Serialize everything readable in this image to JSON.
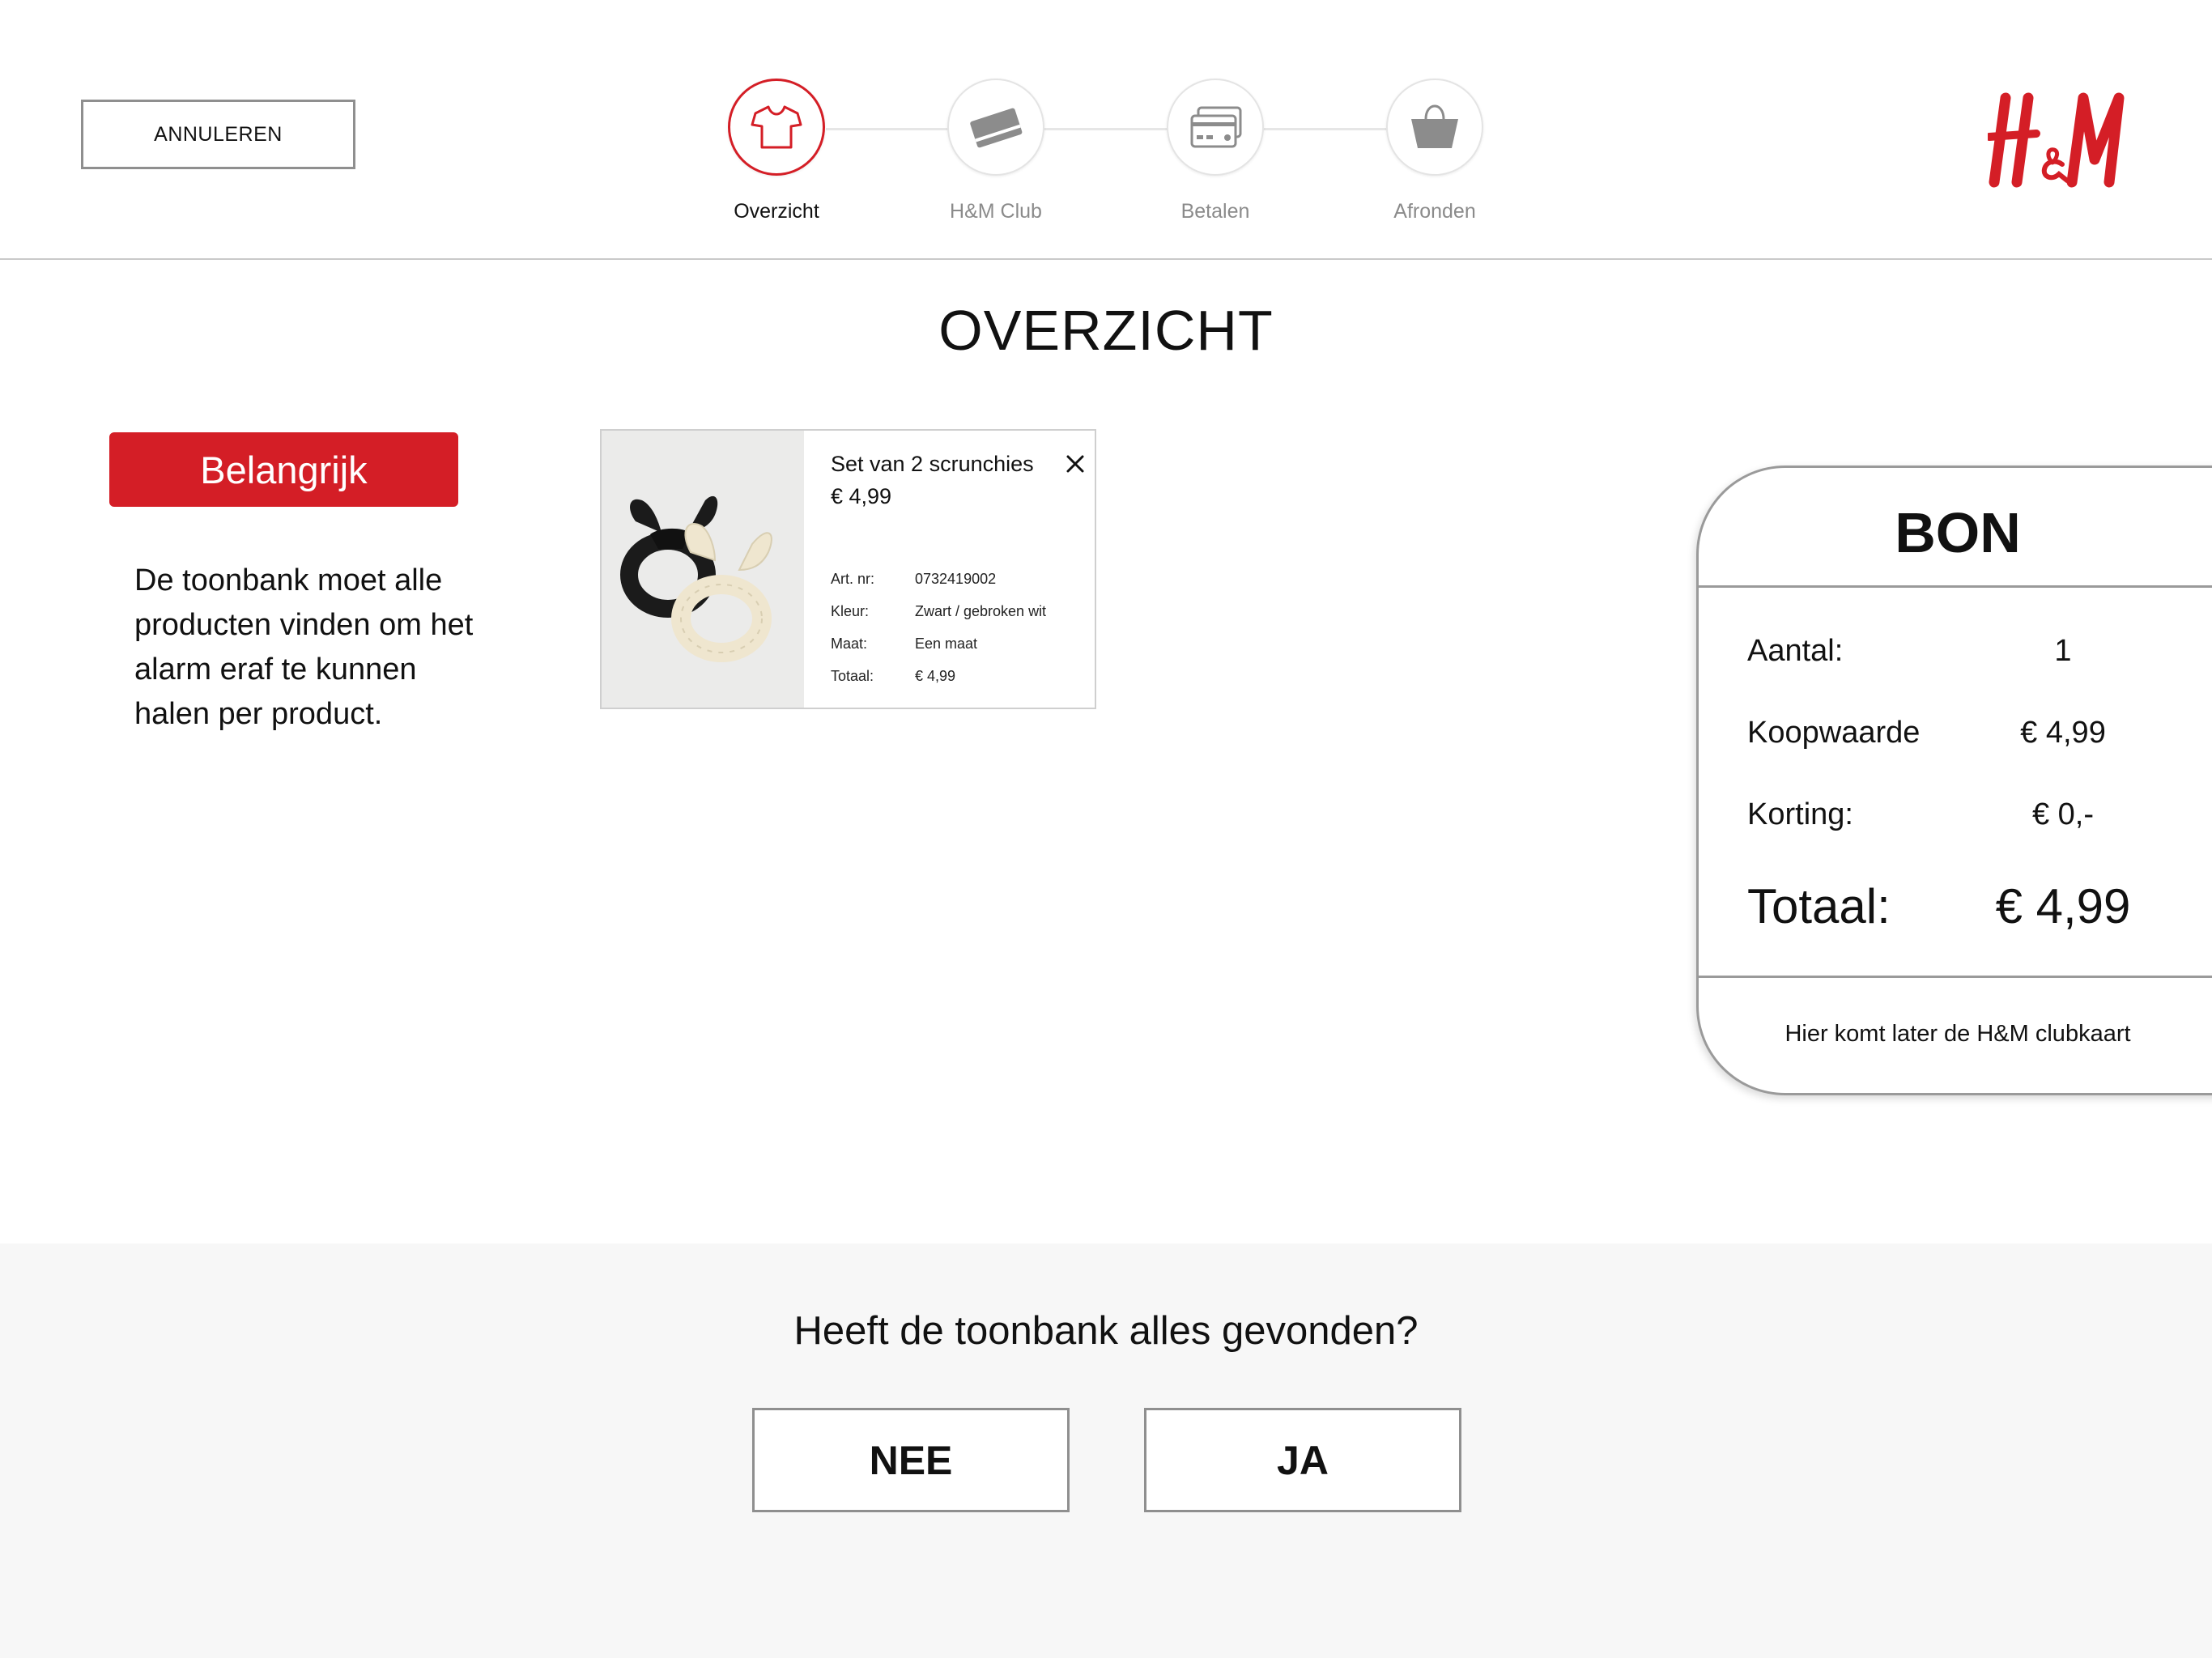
{
  "header": {
    "cancel_label": "ANNULEREN",
    "steps": [
      {
        "label": "Overzicht",
        "icon": "tshirt-icon"
      },
      {
        "label": "H&M Club",
        "icon": "club-card-icon"
      },
      {
        "label": "Betalen",
        "icon": "credit-cards-icon"
      },
      {
        "label": "Afronden",
        "icon": "shopping-bag-icon"
      }
    ],
    "active_step": "Overzicht",
    "logo_text": "H&M"
  },
  "colors": {
    "accent": "#d41e26",
    "border": "#8f8f8f",
    "inactive": "#8b8b8b",
    "footer_bg": "#f7f7f7"
  },
  "main": {
    "title": "OVERZICHT",
    "important": {
      "badge": "Belangrijk",
      "text": "De toonbank moet alle producten vinden om het alarm eraf te kunnen halen per product."
    },
    "product": {
      "name": "Set van 2 scrunchies",
      "price": "€ 4,99",
      "specs": [
        {
          "key": "Art. nr:",
          "value": "0732419002"
        },
        {
          "key": "Kleur:",
          "value": "Zwart / gebroken wit"
        },
        {
          "key": "Maat:",
          "value": "Een maat"
        },
        {
          "key": "Totaal:",
          "value": "€ 4,99"
        }
      ]
    }
  },
  "receipt": {
    "title": "BON",
    "rows": [
      {
        "label": "Aantal:",
        "value": "1"
      },
      {
        "label": "Koopwaarde",
        "value": "€ 4,99"
      },
      {
        "label": "Korting:",
        "value": "€ 0,-"
      }
    ],
    "total_label": "Totaal:",
    "total_value": "€ 4,99",
    "footer": "Hier komt later de H&M clubkaart"
  },
  "bottom": {
    "question": "Heeft de toonbank alles gevonden?",
    "no_label": "NEE",
    "yes_label": "JA"
  }
}
